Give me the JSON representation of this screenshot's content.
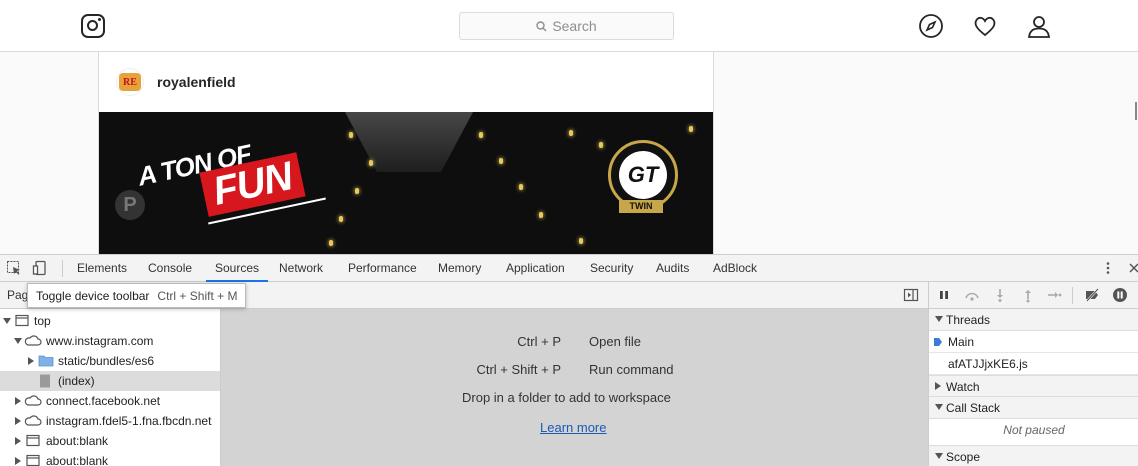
{
  "instagram": {
    "search_placeholder": "Search",
    "post": {
      "username": "royalenfield",
      "avatar_text": "RE",
      "image_text_top": "A TON OF",
      "image_text_main": "FUN",
      "badge_text": "GT",
      "badge_sub": "TWIN",
      "sign_text": "P"
    }
  },
  "devtools": {
    "tabs": [
      "Elements",
      "Console",
      "Sources",
      "Network",
      "Performance",
      "Memory",
      "Application",
      "Security",
      "Audits",
      "AdBlock"
    ],
    "active_tab": "Sources",
    "sub_label": "Page",
    "tooltip": {
      "text": "Toggle device toolbar",
      "shortcut": "Ctrl + Shift + M"
    },
    "tree": [
      {
        "label": "top",
        "icon": "frame-icon",
        "expanded": true
      },
      {
        "label": "www.instagram.com",
        "icon": "cloud-icon",
        "expanded": true
      },
      {
        "label": "static/bundles/es6",
        "icon": "folder-icon",
        "expanded": false
      },
      {
        "label": "(index)",
        "icon": "file-icon",
        "selected": true
      },
      {
        "label": "connect.facebook.net",
        "icon": "cloud-icon",
        "expanded": false
      },
      {
        "label": "instagram.fdel5-1.fna.fbcdn.net",
        "icon": "cloud-icon",
        "expanded": false
      },
      {
        "label": "about:blank",
        "icon": "frame-icon",
        "expanded": false
      },
      {
        "label": "about:blank",
        "icon": "frame-icon",
        "expanded": false
      }
    ],
    "shortcuts": [
      {
        "keys": "Ctrl + P",
        "action": "Open file"
      },
      {
        "keys": "Ctrl + Shift + P",
        "action": "Run command"
      }
    ],
    "drop_text": "Drop in a folder to add to workspace",
    "learn_more": "Learn more",
    "debugger": {
      "threads_label": "Threads",
      "threads": [
        "Main",
        "afATJJjxKE6.js"
      ],
      "watch_label": "Watch",
      "call_stack_label": "Call Stack",
      "not_paused": "Not paused",
      "scope_label": "Scope"
    }
  },
  "colors": {
    "accent": "#1a73e8",
    "fun_red": "#d6171d",
    "badge_gold": "#c8a64a"
  }
}
